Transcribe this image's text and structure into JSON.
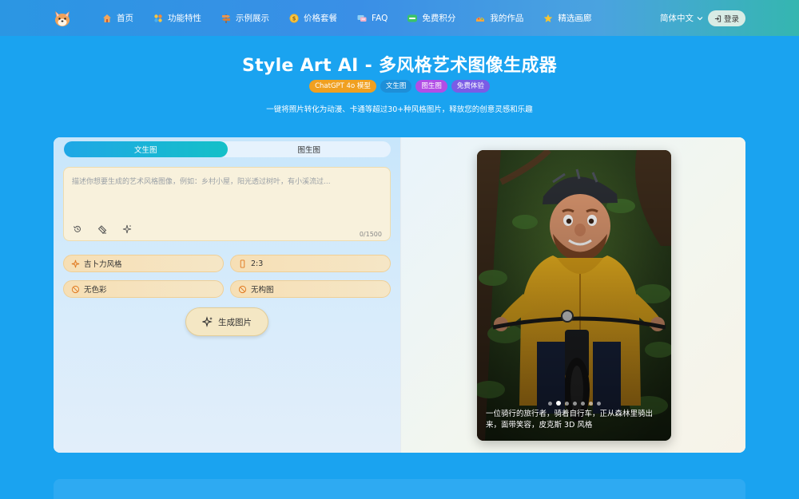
{
  "nav": {
    "items": [
      {
        "label": "首页",
        "icon": "home-icon"
      },
      {
        "label": "功能特性",
        "icon": "features-icon"
      },
      {
        "label": "示例展示",
        "icon": "signpost-icon"
      },
      {
        "label": "价格套餐",
        "icon": "coin-icon"
      },
      {
        "label": "FAQ",
        "icon": "faq-icon"
      },
      {
        "label": "免费积分",
        "icon": "free-badge-icon"
      },
      {
        "label": "我的作品",
        "icon": "works-icon"
      },
      {
        "label": "精选画廊",
        "icon": "star-icon"
      }
    ],
    "language": "简体中文",
    "login": "登录",
    "colors": {
      "accent": "#1aa3f0",
      "teal": "#14c0c8"
    }
  },
  "hero": {
    "title": "Style Art AI - 多风格艺术图像生成器",
    "tags": [
      {
        "label": "ChatGPT 4o 模型",
        "color": "#f0a020"
      },
      {
        "label": "文生图",
        "color": "#1e8fd8"
      },
      {
        "label": "图生图",
        "color": "#b24ee6"
      },
      {
        "label": "免费体验",
        "color": "#7a5ce6"
      }
    ],
    "subtitle": "一键将照片转化为动漫、卡通等超过30+种风格图片，释放您的创意灵感和乐趣"
  },
  "generator": {
    "tabs": [
      "文生图",
      "图生图"
    ],
    "active_tab": 0,
    "prompt_placeholder": "描述你想要生成的艺术风格图像，例如：乡村小屋，阳光透过树叶，有小溪流过...",
    "prompt_value": "",
    "counter": "0/1500",
    "options": {
      "style": "吉卜力风格",
      "ratio": "2:3",
      "color": "无色彩",
      "composition": "无构图"
    },
    "generate_label": "生成图片"
  },
  "preview": {
    "caption": "一位骑行的旅行者，骑着自行车，正从森林里骑出来，面带笑容，皮克斯 3D 风格",
    "dot_count": 7,
    "active_dot": 1
  }
}
